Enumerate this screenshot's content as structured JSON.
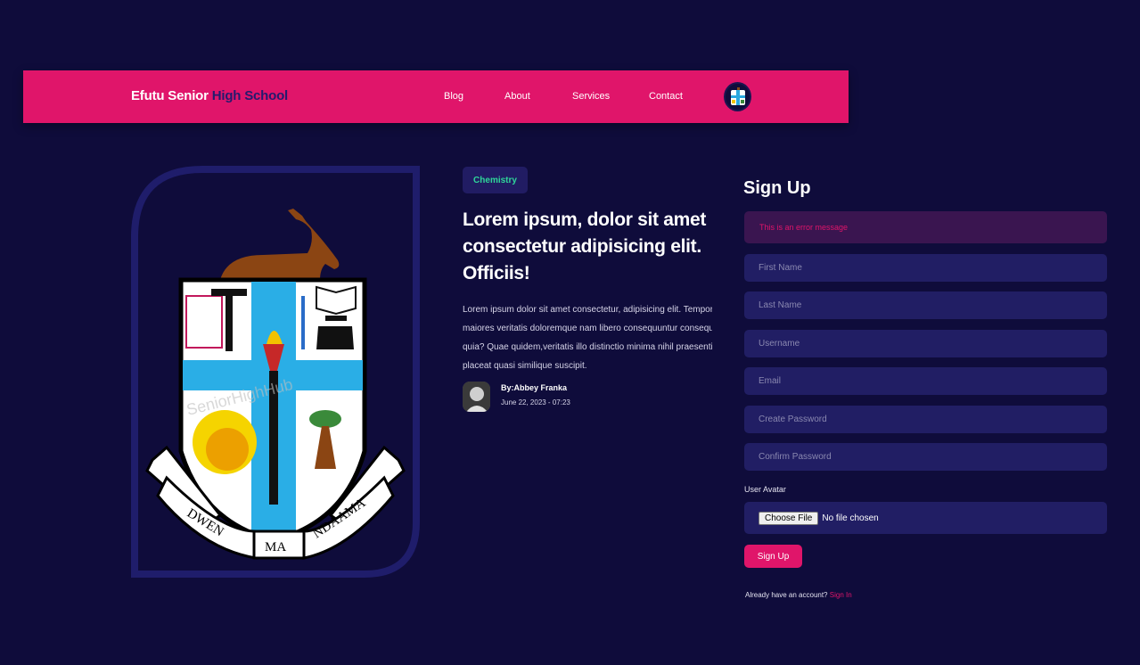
{
  "brand": {
    "part1": "Efutu Senior ",
    "part2": "High School"
  },
  "nav": {
    "items": [
      {
        "label": "Blog"
      },
      {
        "label": "About"
      },
      {
        "label": "Services"
      },
      {
        "label": "Contact"
      }
    ],
    "avatar_icon": "school-crest-avatar-icon"
  },
  "crest": {
    "watermark": "SeniorHighHub",
    "motto_left": "DWEN",
    "motto_center": "MA",
    "motto_right": "NDAAMA"
  },
  "article": {
    "category": "Chemistry",
    "title": "Lorem ipsum, dolor sit amet consectetur adipisicing elit. Officiis!",
    "body_lines": [
      "Lorem ipsum dolor sit amet consectetur, adipisicing elit. Tempora",
      "maiores veritatis doloremque nam libero consequuntur consequatur",
      "quia? Quae quidem,veritatis illo distinctio minima nihil praesentium",
      "placeat quasi similique suscipit."
    ],
    "author": "By:Abbey Franka",
    "date": "June 22, 2023 - 07:23"
  },
  "signup": {
    "title": "Sign Up",
    "error": "This is an error message",
    "fields": {
      "first_name": "First Name",
      "last_name": "Last Name",
      "username": "Username",
      "email": "Email",
      "create_password": "Create Password",
      "confirm_password": "Confirm Password"
    },
    "avatar_label": "User Avatar",
    "file_button": "Choose File",
    "file_status": "No file chosen",
    "submit": "Sign Up",
    "account_text": "Already have an account?",
    "signin_link": "Sign In"
  },
  "colors": {
    "background": "#0f0c3b",
    "navbar": "#e0156a",
    "accent_dark": "#241a6e",
    "badge_text": "#2fd69a",
    "input_bg": "#211e64"
  }
}
